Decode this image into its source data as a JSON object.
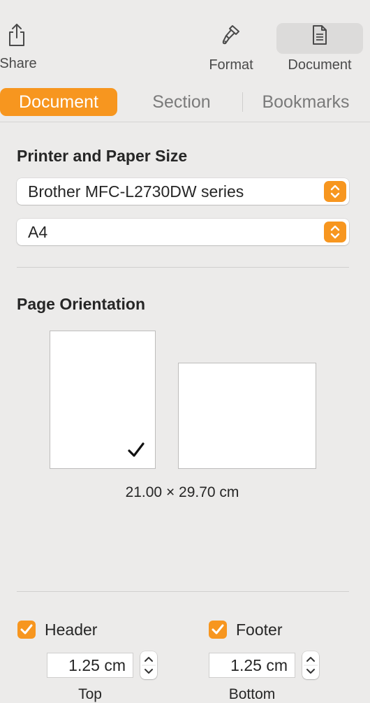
{
  "toolbar": {
    "share_label": "Share",
    "format_label": "Format",
    "document_label": "Document"
  },
  "tabs": [
    {
      "label": "Document",
      "active": true
    },
    {
      "label": "Section",
      "active": false
    },
    {
      "label": "Bookmarks",
      "active": false
    }
  ],
  "printer_section": {
    "title": "Printer and Paper Size",
    "printer": "Brother MFC-L2730DW series",
    "paper_size": "A4"
  },
  "orientation_section": {
    "title": "Page Orientation",
    "selected": "portrait",
    "dimensions": "21.00 × 29.70 cm"
  },
  "header_footer": {
    "header": {
      "label": "Header",
      "checked": true,
      "value": "1.25 cm",
      "caption": "Top"
    },
    "footer": {
      "label": "Footer",
      "checked": true,
      "value": "1.25 cm",
      "caption": "Bottom"
    }
  },
  "colors": {
    "accent": "#f7961f",
    "background": "#ecebea"
  }
}
